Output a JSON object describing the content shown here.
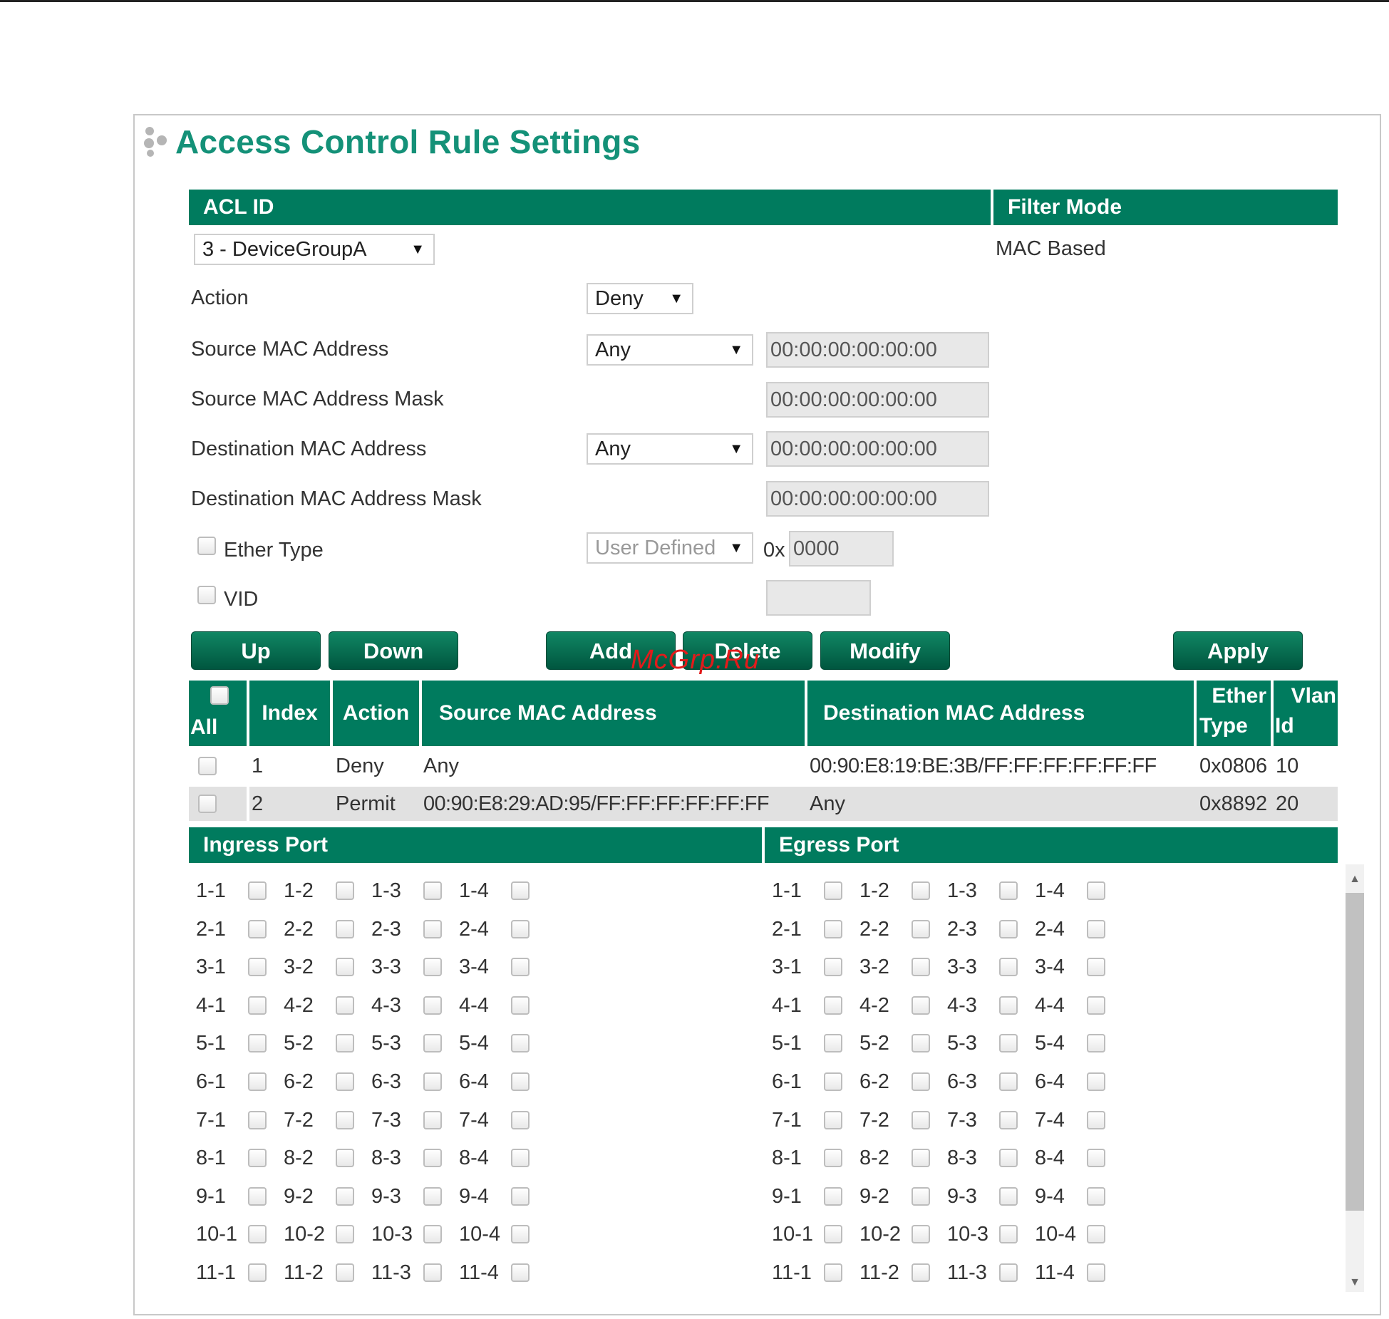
{
  "title": "Access Control Rule Settings",
  "acl_header": {
    "acl_id_label": "ACL ID",
    "filter_mode_label": "Filter Mode"
  },
  "acl_id": {
    "value": "3 - DeviceGroupA"
  },
  "filter_mode": {
    "value": "MAC Based"
  },
  "form": {
    "action": {
      "label": "Action",
      "value": "Deny"
    },
    "source_mac": {
      "label": "Source MAC Address",
      "select": "Any",
      "value": "00:00:00:00:00:00"
    },
    "source_mask": {
      "label": "Source MAC Address Mask",
      "value": "00:00:00:00:00:00"
    },
    "dest_mac": {
      "label": "Destination MAC Address",
      "select": "Any",
      "value": "00:00:00:00:00:00"
    },
    "dest_mask": {
      "label": "Destination MAC Address Mask",
      "value": "00:00:00:00:00:00"
    },
    "ether_type": {
      "label": "Ether Type",
      "select": "User Defined",
      "prefix": "0x",
      "value": "0000"
    },
    "vid": {
      "label": "VID",
      "value": ""
    }
  },
  "buttons": {
    "up": "Up",
    "down": "Down",
    "add": "Add",
    "delete": "Delete",
    "modify": "Modify",
    "apply": "Apply"
  },
  "watermark": "McGrp.Ru",
  "rules_table": {
    "headers": {
      "all": "All",
      "index": "Index",
      "action": "Action",
      "src": "Source MAC Address",
      "dst": "Destination MAC Address",
      "ether_1": "Ether",
      "ether_2": "Type",
      "vlan_1": "Vlan",
      "vlan_2": "Id"
    },
    "rows": [
      {
        "index": "1",
        "action": "Deny",
        "src": "Any",
        "dst": "00:90:E8:19:BE:3B/FF:FF:FF:FF:FF:FF",
        "ether": "0x0806",
        "vlan": "10"
      },
      {
        "index": "2",
        "action": "Permit",
        "src": "00:90:E8:29:AD:95/FF:FF:FF:FF:FF:FF",
        "dst": "Any",
        "ether": "0x8892",
        "vlan": "20"
      }
    ]
  },
  "ports": {
    "ingress_label": "Ingress Port",
    "egress_label": "Egress Port",
    "rows": [
      [
        "1-1",
        "1-2",
        "1-3",
        "1-4"
      ],
      [
        "2-1",
        "2-2",
        "2-3",
        "2-4"
      ],
      [
        "3-1",
        "3-2",
        "3-3",
        "3-4"
      ],
      [
        "4-1",
        "4-2",
        "4-3",
        "4-4"
      ],
      [
        "5-1",
        "5-2",
        "5-3",
        "5-4"
      ],
      [
        "6-1",
        "6-2",
        "6-3",
        "6-4"
      ],
      [
        "7-1",
        "7-2",
        "7-3",
        "7-4"
      ],
      [
        "8-1",
        "8-2",
        "8-3",
        "8-4"
      ],
      [
        "9-1",
        "9-2",
        "9-3",
        "9-4"
      ],
      [
        "10-1",
        "10-2",
        "10-3",
        "10-4"
      ],
      [
        "11-1",
        "11-2",
        "11-3",
        "11-4"
      ]
    ]
  },
  "colors": {
    "accent": "#007b5e",
    "title": "#149178",
    "row_alt": "#e1e1e1"
  }
}
